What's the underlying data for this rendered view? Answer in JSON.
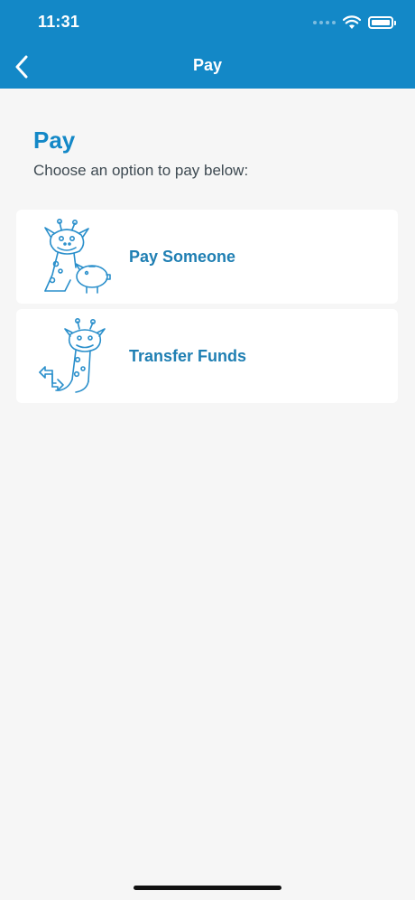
{
  "status_bar": {
    "time": "11:31",
    "icons": [
      "signal-icon",
      "wifi-icon",
      "battery-icon"
    ]
  },
  "nav": {
    "back_icon": "chevron-left-icon",
    "title": "Pay"
  },
  "main": {
    "title": "Pay",
    "subtitle": "Choose an option to pay below:",
    "options": [
      {
        "label": "Pay Someone",
        "icon": "giraffe-piggy-bank-illustration"
      },
      {
        "label": "Transfer Funds",
        "icon": "giraffe-transfer-arrows-illustration"
      }
    ]
  },
  "colors": {
    "brand": "#1388c7",
    "background": "#f6f6f6",
    "card": "#ffffff",
    "option_label": "#1f7fb3",
    "subtitle": "#3e4a52"
  }
}
